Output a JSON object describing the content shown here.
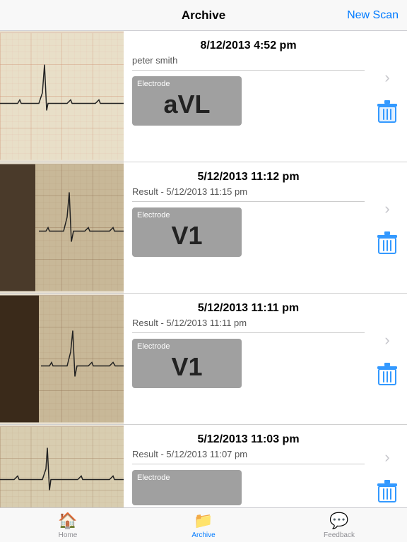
{
  "header": {
    "title": "Archive",
    "new_scan_label": "New Scan"
  },
  "items": [
    {
      "id": 1,
      "date": "8/12/2013 4:52 pm",
      "sub": "peter smith",
      "electrode_label": "Electrode",
      "electrode_value": "aVL"
    },
    {
      "id": 2,
      "date": "5/12/2013 11:12 pm",
      "sub": "Result -  5/12/2013 11:15 pm",
      "electrode_label": "Electrode",
      "electrode_value": "V1"
    },
    {
      "id": 3,
      "date": "5/12/2013 11:11 pm",
      "sub": "Result -  5/12/2013 11:11 pm",
      "electrode_label": "Electrode",
      "electrode_value": "V1"
    },
    {
      "id": 4,
      "date": "5/12/2013 11:03 pm",
      "sub": "Result -  5/12/2013 11:07 pm",
      "electrode_label": "Electrode",
      "electrode_value": ""
    }
  ],
  "tabs": [
    {
      "id": "home",
      "label": "Home",
      "icon": "🏠",
      "active": false
    },
    {
      "id": "archive",
      "label": "Archive",
      "icon": "📁",
      "active": true
    },
    {
      "id": "feedback",
      "label": "Feedback",
      "icon": "💬",
      "active": false
    }
  ]
}
